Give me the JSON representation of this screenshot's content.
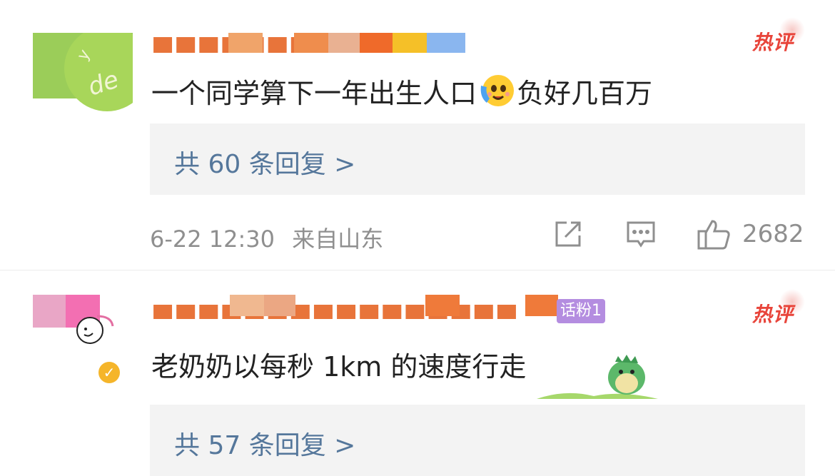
{
  "hot_badge_label": "热评",
  "comments": [
    {
      "text": "一个同学算下一年出生人口😭负好几百万",
      "text_before_emoji": "一个同学算下一年出生人口",
      "emoji": "tearful-happy-emoji",
      "text_after_emoji": "负好几百万",
      "replies_link": "共 60 条回复 >",
      "date": "6-22 12:30",
      "location": "来自山东",
      "like_count": "2682",
      "actions": [
        "share-icon",
        "comment-icon",
        "thumbs-up-icon"
      ]
    },
    {
      "text": "老奶奶以每秒 1km 的速度行走",
      "fan_badge": "话粉1",
      "replies_link": "共 57 条回复 >"
    }
  ],
  "colors": {
    "username": "#e8743a",
    "hot_badge": "#e8443a",
    "reply_link": "#55779b",
    "reply_box_bg": "#f3f3f3",
    "meta_text": "#8f8f8f"
  }
}
